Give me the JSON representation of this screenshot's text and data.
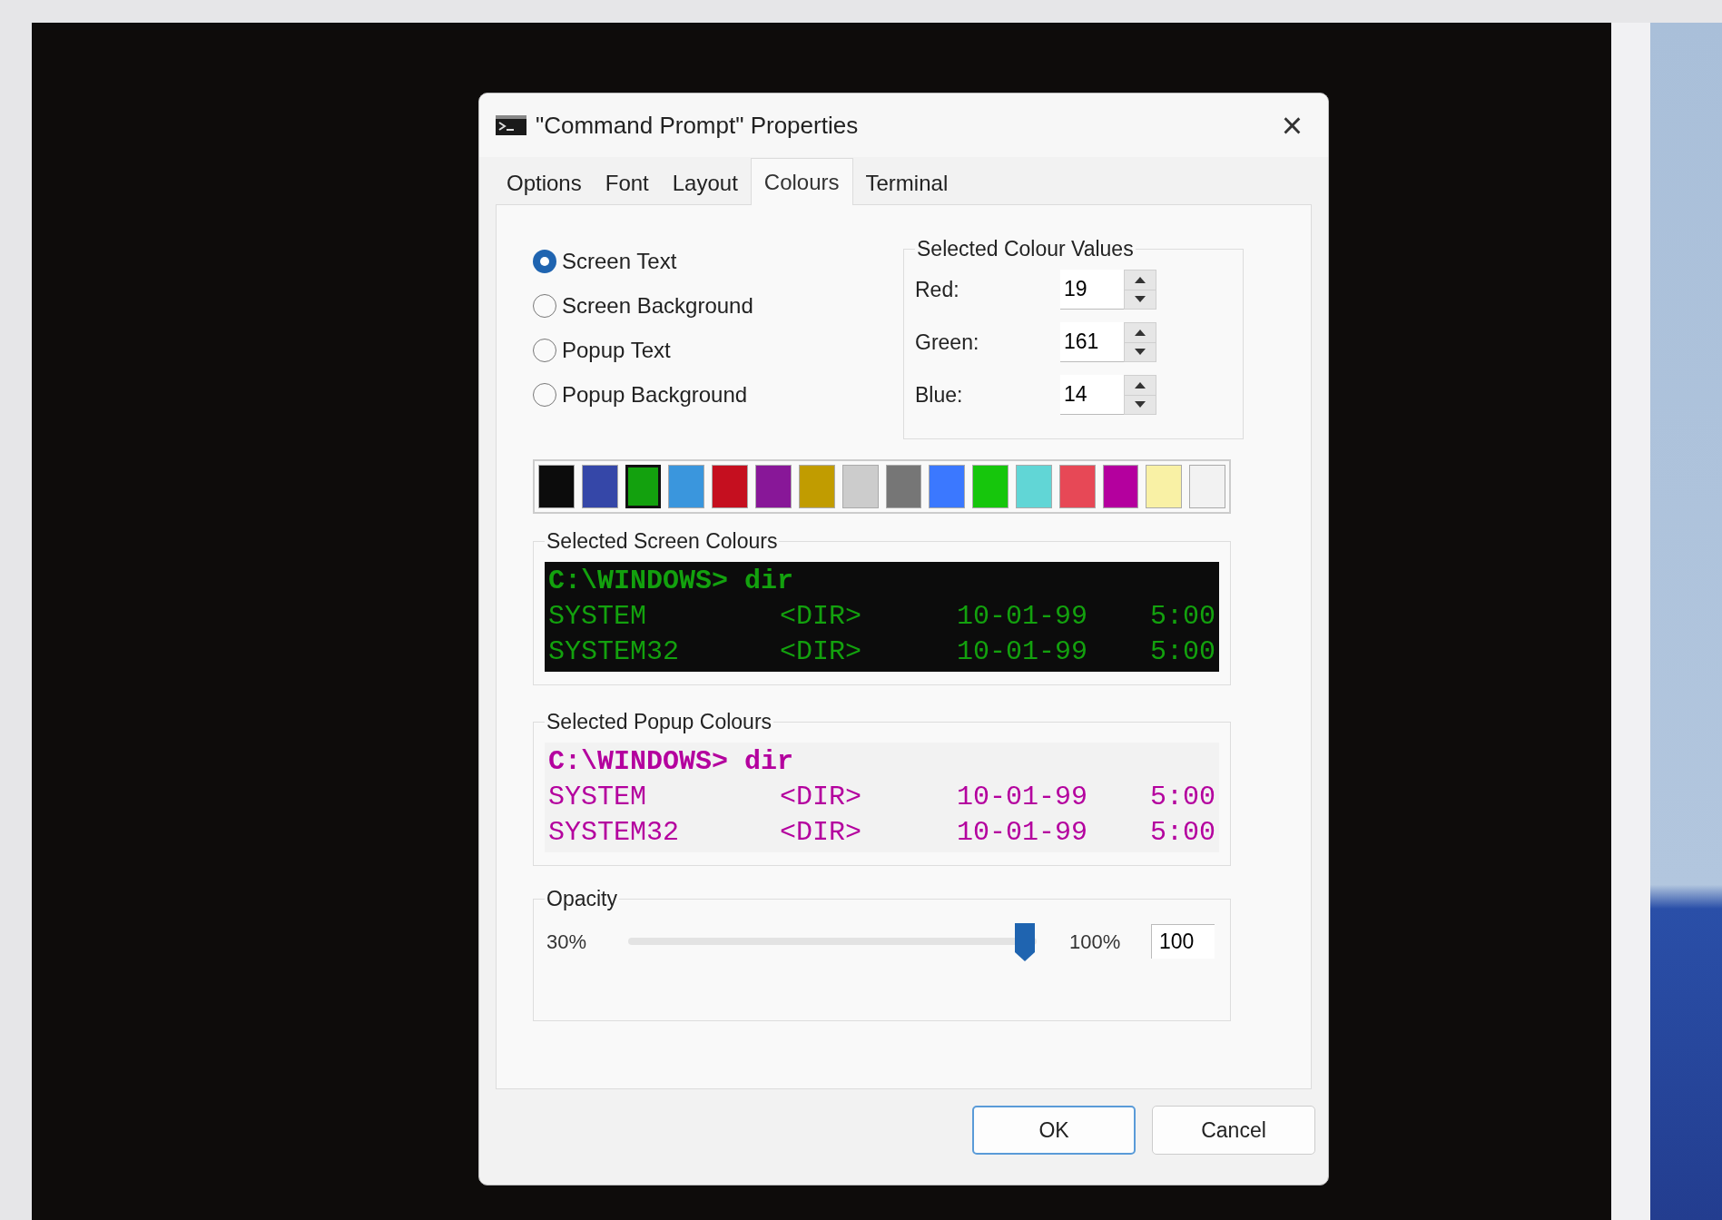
{
  "window": {
    "title": "\"Command Prompt\" Properties",
    "close": "×"
  },
  "tabs": [
    {
      "label": "Options",
      "selected": false
    },
    {
      "label": "Font",
      "selected": false
    },
    {
      "label": "Layout",
      "selected": false
    },
    {
      "label": "Colours",
      "selected": true
    },
    {
      "label": "Terminal",
      "selected": false
    }
  ],
  "targets": [
    {
      "label": "Screen Text",
      "selected": true
    },
    {
      "label": "Screen Background",
      "selected": false
    },
    {
      "label": "Popup Text",
      "selected": false
    },
    {
      "label": "Popup Background",
      "selected": false
    }
  ],
  "colour_values": {
    "title": "Selected Colour Values",
    "fields": [
      {
        "label": "Red:",
        "value": "19"
      },
      {
        "label": "Green:",
        "value": "161"
      },
      {
        "label": "Blue:",
        "value": "14"
      }
    ]
  },
  "palette": [
    {
      "color": "#0c0c0c",
      "selected": false
    },
    {
      "color": "#3547a8",
      "selected": false
    },
    {
      "color": "#13a10e",
      "selected": true
    },
    {
      "color": "#3a96dd",
      "selected": false
    },
    {
      "color": "#c50f1f",
      "selected": false
    },
    {
      "color": "#881798",
      "selected": false
    },
    {
      "color": "#c19c00",
      "selected": false
    },
    {
      "color": "#cccccc",
      "selected": false
    },
    {
      "color": "#767676",
      "selected": false
    },
    {
      "color": "#3b78ff",
      "selected": false
    },
    {
      "color": "#16c60c",
      "selected": false
    },
    {
      "color": "#61d6d6",
      "selected": false
    },
    {
      "color": "#e74856",
      "selected": false
    },
    {
      "color": "#b4009e",
      "selected": false
    },
    {
      "color": "#f9f1a5",
      "selected": false
    },
    {
      "color": "#f2f2f2",
      "selected": false
    }
  ],
  "previews": [
    {
      "title": "Selected Screen Colours",
      "kind": "screen",
      "color": "#13a10e",
      "prompt": "C:\\WINDOWS> dir",
      "rows": [
        [
          "SYSTEM",
          "<DIR>",
          "10-01-99",
          "5:00"
        ],
        [
          "SYSTEM32",
          "<DIR>",
          "10-01-99",
          "5:00"
        ]
      ]
    },
    {
      "title": "Selected Popup Colours",
      "kind": "popup",
      "color": "#b4009e",
      "prompt": "C:\\WINDOWS> dir",
      "rows": [
        [
          "SYSTEM",
          "<DIR>",
          "10-01-99",
          "5:00"
        ],
        [
          "SYSTEM32",
          "<DIR>",
          "10-01-99",
          "5:00"
        ]
      ]
    }
  ],
  "opacity": {
    "title": "Opacity",
    "min_label": "30%",
    "max_label": "100%",
    "level": 1,
    "value": "100"
  },
  "buttons": [
    {
      "label": "OK",
      "default": true
    },
    {
      "label": "Cancel",
      "default": false
    }
  ]
}
